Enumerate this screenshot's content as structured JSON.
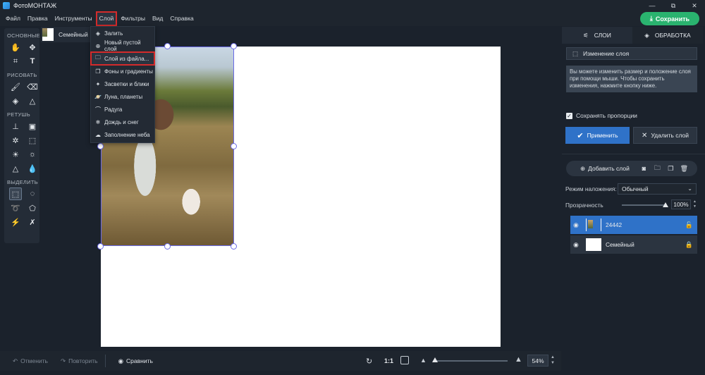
{
  "window": {
    "title": "ФотоМОНТАЖ",
    "controls": [
      "—",
      "⧉",
      "✕"
    ]
  },
  "menubar": {
    "items": [
      "Файл",
      "Правка",
      "Инструменты",
      "Слой",
      "Фильтры",
      "Вид",
      "Справка"
    ],
    "active": "Слой",
    "save_label": "Сохранить"
  },
  "tools": {
    "sections": [
      {
        "title": "ОСНОВНЫЕ"
      },
      {
        "title": "РИСОВАТЬ"
      },
      {
        "title": "РЕТУШЬ"
      },
      {
        "title": "ВЫДЕЛИТЬ"
      }
    ]
  },
  "document": {
    "tab_label": "Семейный"
  },
  "layer_menu": {
    "items": [
      {
        "label": "Залить"
      },
      {
        "label": "Новый пустой слой"
      },
      {
        "label": "Слой из файла..."
      },
      {
        "label": "Фоны и градиенты"
      },
      {
        "label": "Засветки и блики"
      },
      {
        "label": "Луна, планеты"
      },
      {
        "label": "Радуга"
      },
      {
        "label": "Дождь и снег"
      },
      {
        "label": "Заполнение неба"
      }
    ],
    "highlighted": "Слой из файла..."
  },
  "bottombar": {
    "undo_label": "Отменить",
    "redo_label": "Повторить",
    "compare_label": "Сравнить",
    "zoom_one_to_one": "1:1",
    "zoom_value": "54%",
    "zoom_level": 0.03
  },
  "right_panel": {
    "tabs": [
      {
        "label": "СЛОИ"
      },
      {
        "label": "ОБРАБОТКА"
      }
    ],
    "active_tab": "СЛОИ",
    "resize_label": "Изменение слоя",
    "info_text": "Вы можете изменить размер и положение слоя при помощи мыши. Чтобы сохранить изменения, нажмите кнопку ниже.",
    "keep_ratio_label": "Сохранять пропорции",
    "keep_ratio_checked": true,
    "apply_label": "Применить",
    "delete_label": "Удалить слой",
    "add_layer_label": "Добавить слой",
    "blend_label": "Режим наложения:",
    "blend_value": "Обычный",
    "opacity_label": "Прозрачность",
    "opacity_value": "100%",
    "opacity_level": 1.0,
    "layers": [
      {
        "name": "24442",
        "selected": true,
        "locked": false
      },
      {
        "name": "Семейный",
        "selected": false,
        "locked": true
      }
    ]
  },
  "colors": {
    "accent_save": "#2ab36f",
    "accent_blue": "#2f72c8",
    "highlight_red": "#d42b2b",
    "selection_outline": "#6a6ae8"
  }
}
